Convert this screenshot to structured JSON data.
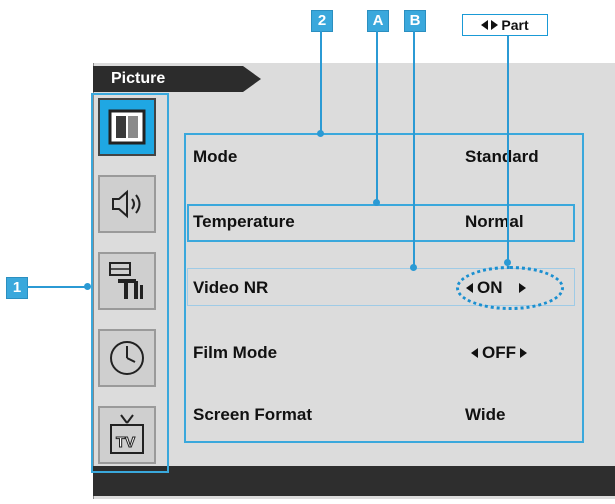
{
  "callouts": {
    "b2": "2",
    "bA": "A",
    "bB": "B",
    "b1": "1",
    "part_label": "Part"
  },
  "osd": {
    "title": "Picture",
    "sidebar": [
      {
        "icon": "picture-icon",
        "active": true
      },
      {
        "icon": "sound-icon",
        "active": false
      },
      {
        "icon": "setup-tools-icon",
        "active": false
      },
      {
        "icon": "clock-icon",
        "active": false
      },
      {
        "icon": "tv-icon",
        "active": false
      }
    ],
    "rows": [
      {
        "label": "Mode",
        "value": "Standard",
        "arrows": false
      },
      {
        "label": "Temperature",
        "value": "Normal",
        "arrows": false
      },
      {
        "label": "Video NR",
        "value": "ON",
        "arrows": true
      },
      {
        "label": "Film Mode",
        "value": "OFF",
        "arrows": true
      },
      {
        "label": "Screen Format",
        "value": "Wide",
        "arrows": false
      }
    ]
  },
  "colors": {
    "accent": "#3aa8dc",
    "osd_background": "#dcdcdc",
    "bar": "#2c2c2c",
    "active_icon": "#1fa7e3"
  }
}
